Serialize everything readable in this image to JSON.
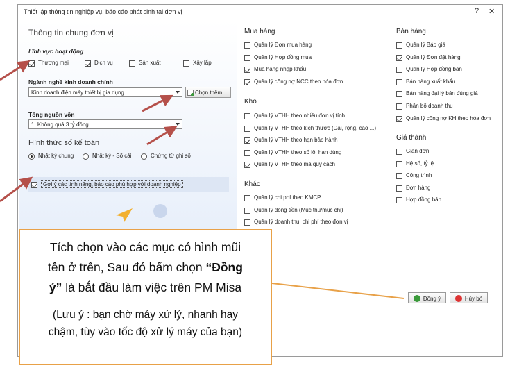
{
  "window": {
    "title": "Thiết lập thông tin nghiệp vụ, báo cáo phát sinh tại đơn vị",
    "help": "?",
    "close": "✕"
  },
  "general": {
    "heading": "Thông tin chung đơn vị",
    "field_label": "Lĩnh vực hoạt động",
    "fields": [
      {
        "label": "Thương mại",
        "checked": true
      },
      {
        "label": "Dịch vụ",
        "checked": true
      },
      {
        "label": "Sản xuất",
        "checked": false
      },
      {
        "label": "Xây lắp",
        "checked": false
      }
    ],
    "industry_label": "Ngành nghề kinh doanh chính",
    "industry_value": "Kinh doanh điện máy thiết bị gia dụng",
    "choose_more": "Chọn thêm...",
    "capital_label": "Tổng nguồn vốn",
    "capital_value": "1. Không quá 3 tỷ đồng",
    "ledger_heading": "Hình thức sổ kế toán",
    "ledger_options": [
      {
        "label": "Nhật ký chung",
        "selected": true
      },
      {
        "label": "Nhật ký - Sổ cái",
        "selected": false
      },
      {
        "label": "Chứng từ ghi sổ",
        "selected": false
      }
    ],
    "suggest_label": "Gợi ý các tính năng, báo cáo phù hợp với doanh nghiệp",
    "suggest_checked": true
  },
  "sections": {
    "purchase": {
      "title": "Mua hàng",
      "items": [
        {
          "label": "Quản lý Đơn mua hàng",
          "checked": false
        },
        {
          "label": "Quản lý Hợp đồng mua",
          "checked": false
        },
        {
          "label": "Mua hàng nhập khẩu",
          "checked": true
        },
        {
          "label": "Quản lý công nợ NCC theo hóa đơn",
          "checked": true
        }
      ]
    },
    "warehouse": {
      "title": "Kho",
      "items": [
        {
          "label": "Quản lý VTHH theo nhiều đơn vị tính",
          "checked": false
        },
        {
          "label": "Quản lý VTHH theo kích thước (Dài, rộng, cao ...)",
          "checked": false
        },
        {
          "label": "Quản lý VTHH theo hạn bảo hành",
          "checked": true
        },
        {
          "label": "Quản lý VTHH theo số lô, hạn dùng",
          "checked": false
        },
        {
          "label": "Quản lý VTHH theo mã quy cách",
          "checked": true
        }
      ]
    },
    "other": {
      "title": "Khác",
      "items": [
        {
          "label": "Quản lý chi phí theo KMCP",
          "checked": false
        },
        {
          "label": "Quản lý dòng tiền (Mục thu/mục chi)",
          "checked": false
        },
        {
          "label": "Quản lý doanh thu, chi phí theo đơn vị",
          "checked": false
        }
      ]
    },
    "sales": {
      "title": "Bán hàng",
      "items": [
        {
          "label": "Quản lý Báo giá",
          "checked": false
        },
        {
          "label": "Quản lý Đơn đặt hàng",
          "checked": true
        },
        {
          "label": "Quản lý Hợp đồng bán",
          "checked": false
        },
        {
          "label": "Bán hàng xuất khẩu",
          "checked": false
        },
        {
          "label": "Bán hàng đại lý bán đúng giá",
          "checked": false
        },
        {
          "label": "Phân bổ doanh thu",
          "checked": false
        },
        {
          "label": "Quản lý công nợ KH theo hóa đơn",
          "checked": true
        }
      ]
    },
    "cost": {
      "title": "Giá thành",
      "items": [
        {
          "label": "Giản đơn",
          "checked": false
        },
        {
          "label": "Hệ số, tỷ lệ",
          "checked": false
        },
        {
          "label": "Công trình",
          "checked": false
        },
        {
          "label": "Đơn hàng",
          "checked": false
        },
        {
          "label": "Hợp đồng bán",
          "checked": false
        }
      ]
    }
  },
  "buttons": {
    "agree": "Đồng ý",
    "cancel": "Hủy bỏ"
  },
  "callout": {
    "line1": "Tích chọn vào các mục có hình mũi",
    "line2_pre": "tên ở trên, Sau đó bấm chọn ",
    "line2_bold": "“Đồng",
    "line3_bold": "ý”",
    "line3_post": " là bắt đầu làm việc trên PM Misa",
    "note_line1": "(Lưu ý : bạn chờ máy xử lý, nhanh hay",
    "note_line2": "chậm, tùy vào tốc độ xử lý máy của bạn)"
  },
  "colors": {
    "arrow": "#b5504a",
    "callout_border": "#e8a148",
    "agree_icon": "#3a9a3a",
    "cancel_icon": "#d33333"
  }
}
